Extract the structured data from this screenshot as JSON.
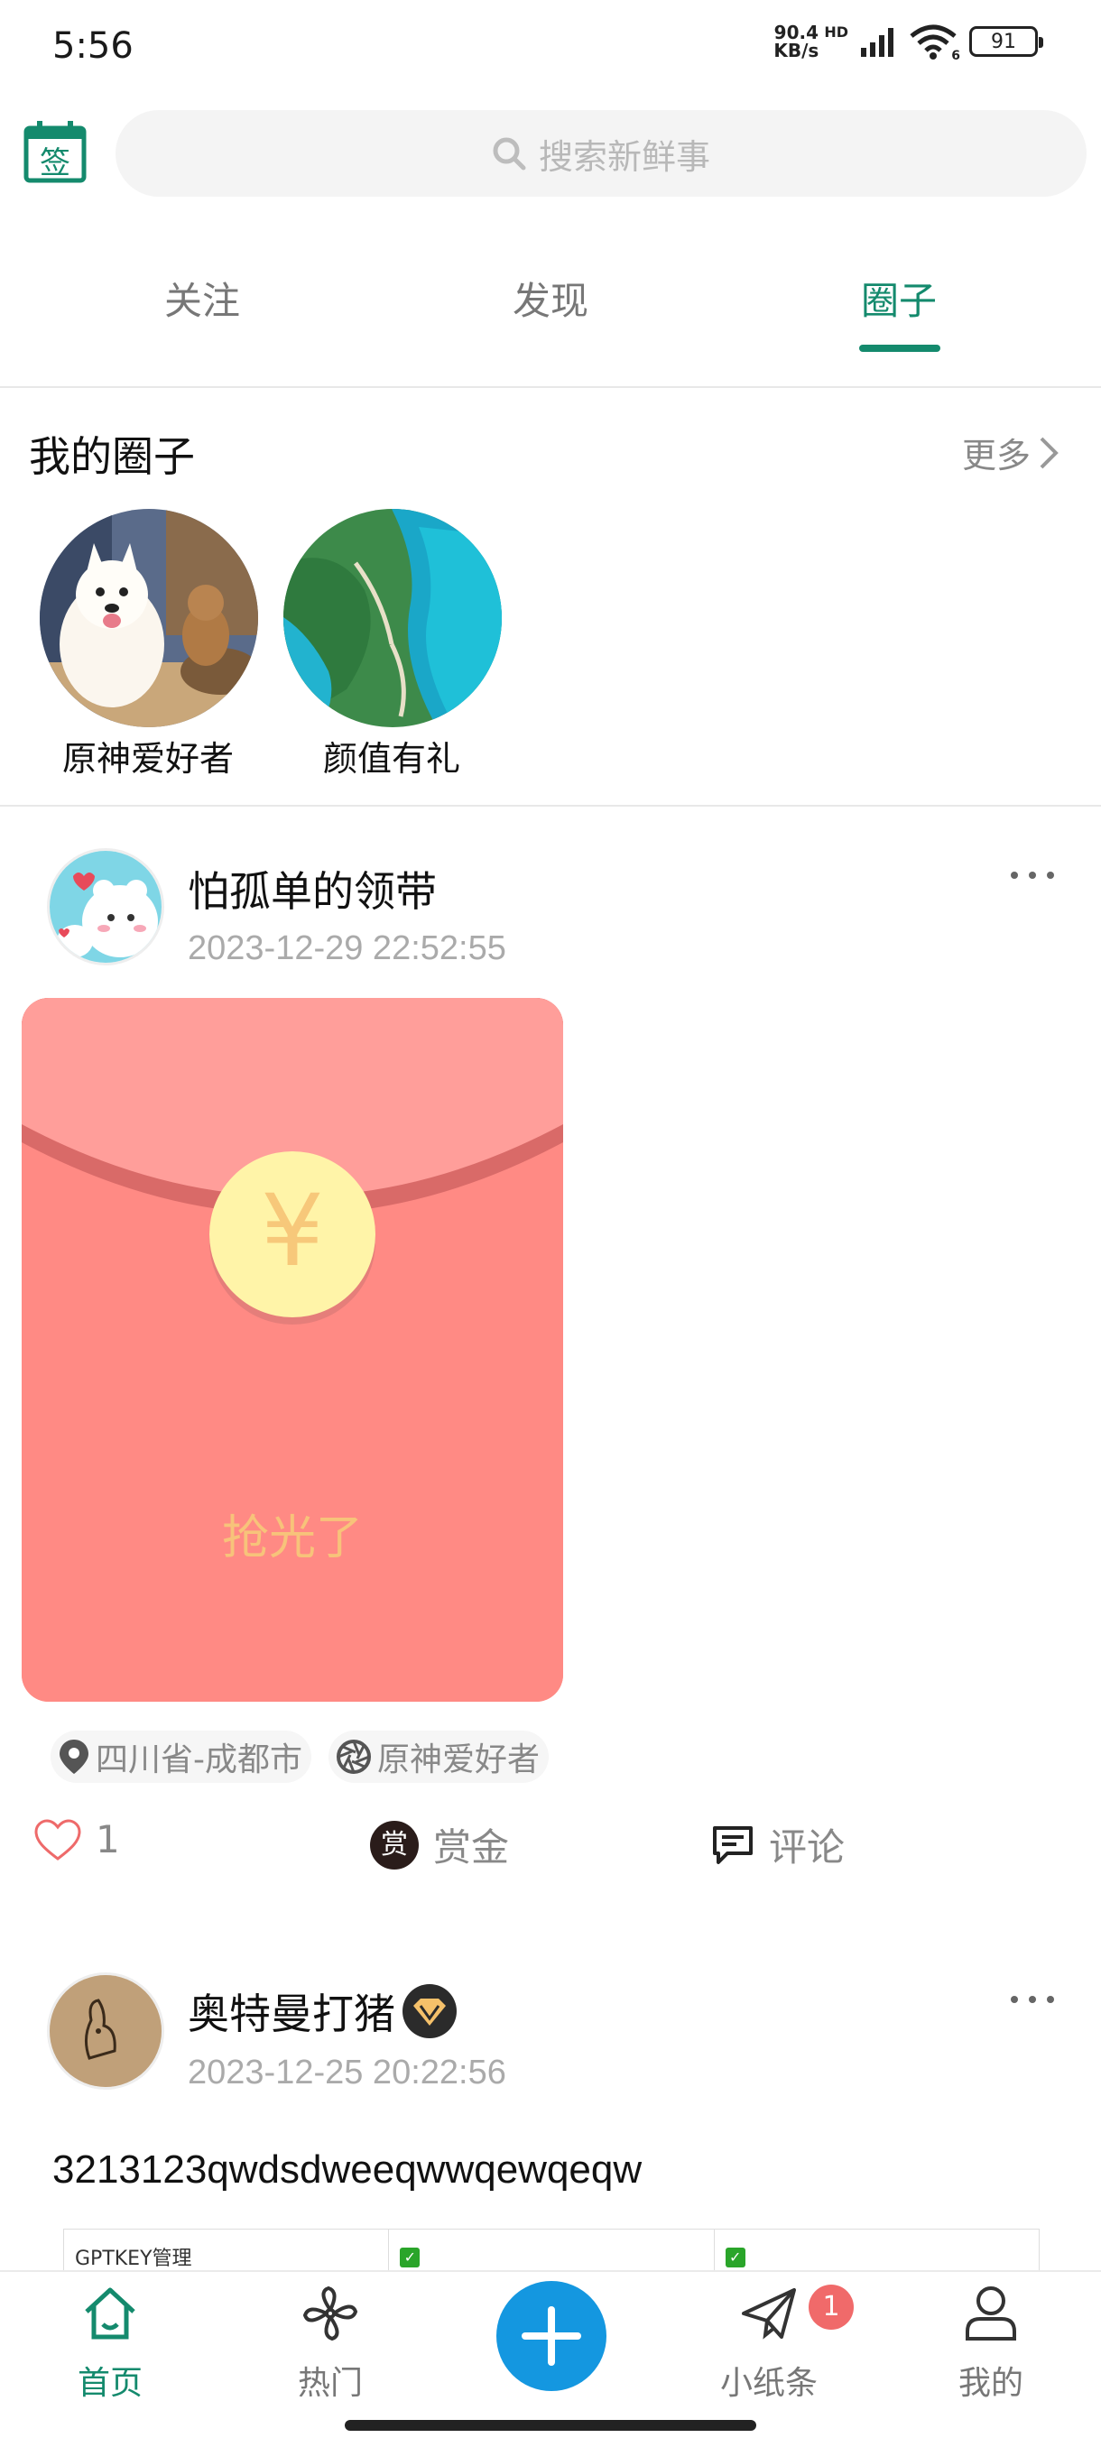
{
  "status_bar": {
    "time": "5:56",
    "net_speed_value": "90.4",
    "net_speed_unit": "KB/s",
    "network_type": "HD",
    "wifi_badge": "6",
    "battery": "91"
  },
  "header": {
    "sign_in_icon_text": "签",
    "search_placeholder": "搜索新鲜事"
  },
  "tabs": [
    {
      "label": "关注",
      "active": false
    },
    {
      "label": "发现",
      "active": false
    },
    {
      "label": "圈子",
      "active": true
    }
  ],
  "my_circles": {
    "title": "我的圈子",
    "more_label": "更多",
    "items": [
      {
        "name": "原神爱好者"
      },
      {
        "name": "颜值有礼"
      }
    ]
  },
  "posts": [
    {
      "author": "怕孤单的领带",
      "time": "2023-12-29 22:52:55",
      "red_packet": {
        "symbol": "¥",
        "status": "抢光了"
      },
      "location_tag": "四川省-成都市",
      "circle_tag": "原神爱好者",
      "likes": "1",
      "reward_badge": "赏",
      "reward_label": "赏金",
      "comment_label": "评论"
    },
    {
      "author": "奥特曼打猪",
      "time": "2023-12-25 20:22:56",
      "content": "3213123qwdsdweeqwwqewqeqw",
      "table_first_cell": "GPTKEY管理"
    }
  ],
  "bottom_nav": {
    "items": [
      {
        "label": "首页",
        "active": true
      },
      {
        "label": "热门",
        "active": false
      },
      {
        "label": "小纸条",
        "active": false
      },
      {
        "label": "我的",
        "active": false
      }
    ],
    "messages_badge": "1"
  },
  "colors": {
    "accent": "#148a6d",
    "fab": "#1497e0",
    "red_packet": "#ff8a84",
    "red_packet_flap": "#ff9e9a",
    "coin": "#fff4a8",
    "badge": "#f06a6a"
  }
}
